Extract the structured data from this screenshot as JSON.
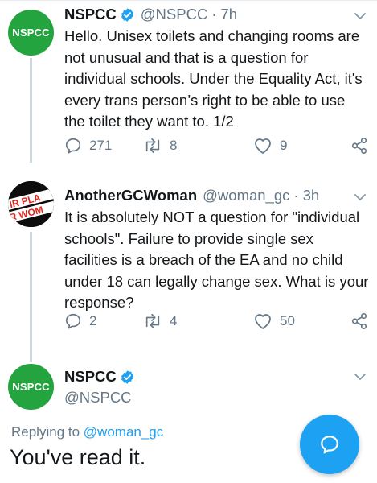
{
  "tweet1": {
    "avatar_text": "NSPCC",
    "name": "NSPCC",
    "handle": "@NSPCC",
    "separator": "·",
    "time": "7h",
    "text": "Hello. Unisex toilets and changing rooms are not unusual and that is a question for individual schools. Under the Equality Act, it's every trans person’s right to be able to use the toilet they want to. 1/2",
    "replies": "271",
    "retweets": "8",
    "likes": "9"
  },
  "tweet2": {
    "avatar_text_top": "IR PLA",
    "avatar_text_bottom": "R WOM",
    "name": "AnotherGCWoman",
    "handle": "@woman_gc",
    "separator": "·",
    "time": "3h",
    "text": "It is absolutely NOT a question for \"individual schools\". Failure to provide single sex facilities is a breach of the EA and no child under 18 can legally change sex. What is your response?",
    "replies": "2",
    "retweets": "4",
    "likes": "50"
  },
  "tweet3": {
    "avatar_text": "NSPCC",
    "name": "NSPCC",
    "handle": "@NSPCC",
    "replying_prefix": "Replying to",
    "replying_to": "@woman_gc",
    "text": "You've read it."
  },
  "colors": {
    "nspcc_green": "#23a43e",
    "twitter_blue": "#1da1f2",
    "secondary_text": "#657786",
    "thread_line": "#ccd6dd"
  },
  "icons": [
    "verified-badge-icon",
    "chevron-down-icon",
    "reply-icon",
    "retweet-icon",
    "like-icon",
    "share-icon",
    "compose-reply-icon"
  ]
}
